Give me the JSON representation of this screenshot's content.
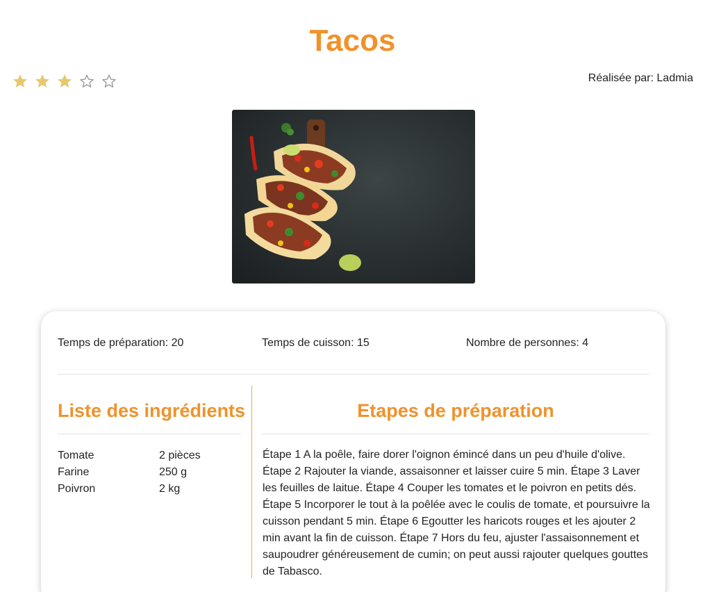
{
  "recipe": {
    "title": "Tacos",
    "rating": 3,
    "rating_max": 5,
    "author_label": "Réalisée par: Ladmia",
    "image_alt": "tacos-photo"
  },
  "meta": {
    "prep_time": "Temps de préparation: 20",
    "cook_time": "Temps de cuisson: 15",
    "servings": "Nombre de personnes: 4"
  },
  "ingredients": {
    "title": "Liste des ingrédients",
    "items": [
      {
        "name": "Tomate",
        "qty": "2 pièces"
      },
      {
        "name": "Farine",
        "qty": "250 g"
      },
      {
        "name": "Poivron",
        "qty": "2 kg"
      }
    ]
  },
  "steps": {
    "title": "Etapes de préparation",
    "text": "Étape 1 A la poêle, faire dorer l'oignon émincé dans un peu d'huile d'olive. Étape 2 Rajouter la viande, assaisonner et laisser cuire 5 min. Étape 3 Laver les feuilles de laitue. Étape 4 Couper les tomates et le poivron en petits dés. Étape 5 Incorporer le tout à la poêlée avec le coulis de tomate, et poursuivre la cuisson pendant 5 min. Étape 6 Egoutter les haricots rouges et les ajouter 2 min avant la fin de cuisson. Étape 7 Hors du feu, ajuster l'assaisonnement et saupoudrer généreusement de cumin; on peut aussi rajouter quelques gouttes de Tabasco."
  },
  "colors": {
    "accent": "#f0922b",
    "star_filled": "#e6c86e",
    "star_empty": "#9a9a9a"
  }
}
